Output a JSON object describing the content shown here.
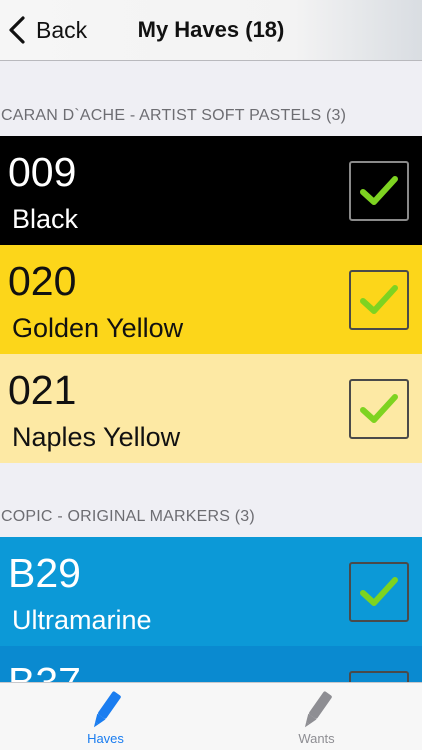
{
  "nav": {
    "back_label": "Back",
    "title": "My Haves (18)"
  },
  "sections": [
    {
      "header": "CARAN D`ACHE - ARTIST SOFT PASTELS (3)",
      "items": [
        {
          "code": "009",
          "name": "Black",
          "bg": "#000000",
          "text": "#ffffff",
          "checked": true
        },
        {
          "code": "020",
          "name": "Golden Yellow",
          "bg": "#fcd61a",
          "text": "#111111",
          "checked": true
        },
        {
          "code": "021",
          "name": "Naples Yellow",
          "bg": "#fde9a4",
          "text": "#111111",
          "checked": true
        }
      ]
    },
    {
      "header": "COPIC - ORIGINAL MARKERS (3)",
      "items": [
        {
          "code": "B29",
          "name": "Ultramarine",
          "bg": "#0c99d7",
          "text": "#ffffff",
          "checked": true
        },
        {
          "code": "B37",
          "name": "",
          "bg": "#0a8ad0",
          "text": "#ffffff",
          "checked": true
        }
      ]
    }
  ],
  "tabbar": {
    "tabs": [
      {
        "label": "Haves",
        "icon": "marker-icon",
        "color": "#1a7df0",
        "active": true
      },
      {
        "label": "Wants",
        "icon": "marker-icon",
        "color": "#8e8e93",
        "active": false
      }
    ]
  },
  "colors": {
    "check_green": "#7ed321",
    "accent": "#1a7df0"
  }
}
